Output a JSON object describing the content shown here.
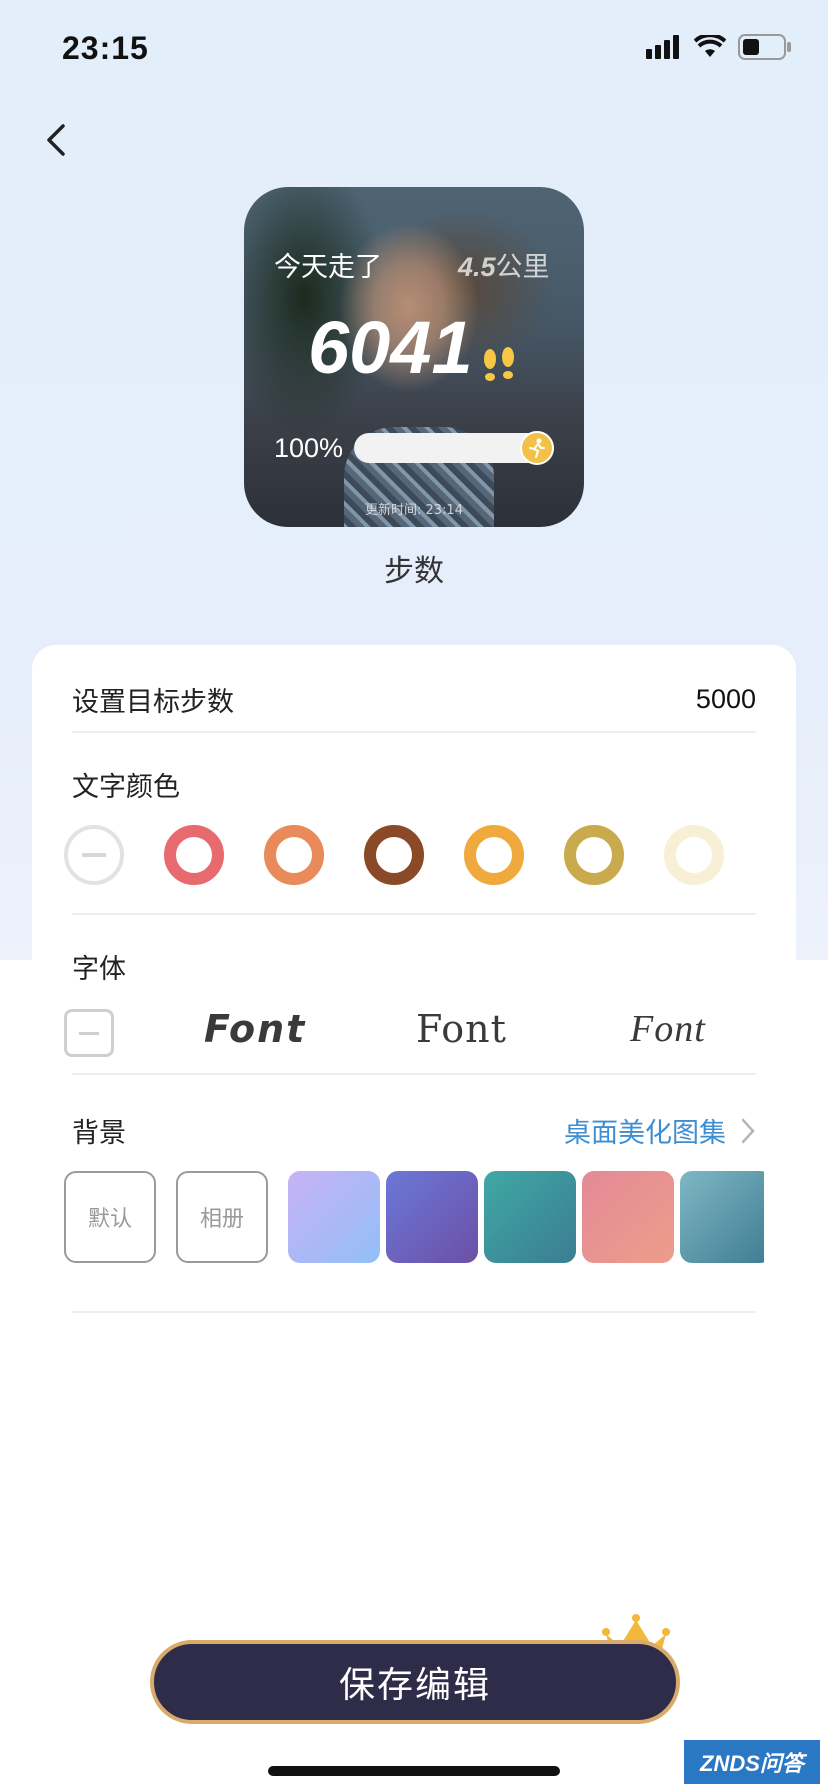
{
  "status_bar": {
    "time": "23:15"
  },
  "widget": {
    "walked_label": "今天走了",
    "distance_value": "4.5",
    "distance_unit": "公里",
    "steps": "6041",
    "progress_label": "100%",
    "progress_fraction": 1.0,
    "update_time": "更新时间: 23:14",
    "name": "步数"
  },
  "settings": {
    "goal_label": "设置目标步数",
    "goal_value": "5000",
    "text_color_title": "文字颜色",
    "text_colors": [
      "none",
      "#e66a6e",
      "#e88a5a",
      "#8a4a28",
      "#f0a93c",
      "#c9aa4c",
      "#f7f0d6"
    ],
    "font_title": "字体",
    "font_samples": [
      "Font",
      "Font",
      "Font"
    ],
    "background_title": "背景",
    "background_link": "桌面美化图集",
    "bg_default": "默认",
    "bg_album": "相册",
    "bg_gradients": [
      [
        "#c7b2f5",
        "#92bff7"
      ],
      [
        "#6a78d8",
        "#6d4fa6"
      ],
      [
        "#3fa8a4",
        "#3b7d92"
      ],
      [
        "#e38a98",
        "#ee9c8a"
      ],
      [
        "#7fb7c4",
        "#3e7c92"
      ]
    ]
  },
  "save_button": {
    "label": "保存编辑"
  },
  "watermark": {
    "text": "ZNDS问答"
  }
}
